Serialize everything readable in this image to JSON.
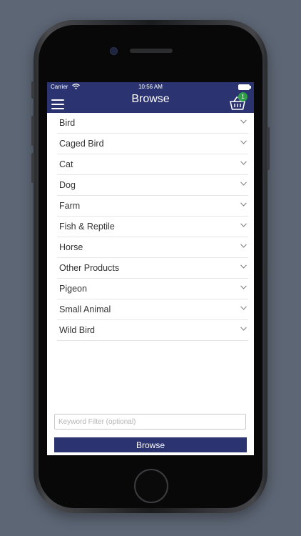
{
  "status_bar": {
    "carrier": "Carrier",
    "time": "10:56 AM"
  },
  "nav": {
    "title": "Browse",
    "cart_count": "1",
    "menu_icon": "hamburger-menu-icon",
    "cart_icon": "basket-icon"
  },
  "categories": [
    {
      "label": "Bird"
    },
    {
      "label": "Caged Bird"
    },
    {
      "label": "Cat"
    },
    {
      "label": "Dog"
    },
    {
      "label": "Farm"
    },
    {
      "label": "Fish & Reptile"
    },
    {
      "label": "Horse"
    },
    {
      "label": "Other Products"
    },
    {
      "label": "Pigeon"
    },
    {
      "label": "Small Animal"
    },
    {
      "label": "Wild Bird"
    }
  ],
  "filter": {
    "placeholder": "Keyword Filter (optional)",
    "value": ""
  },
  "browse_button": {
    "label": "Browse"
  },
  "colors": {
    "brand": "#2b3370",
    "badge": "#2e9e48",
    "background": "#5d6675"
  }
}
